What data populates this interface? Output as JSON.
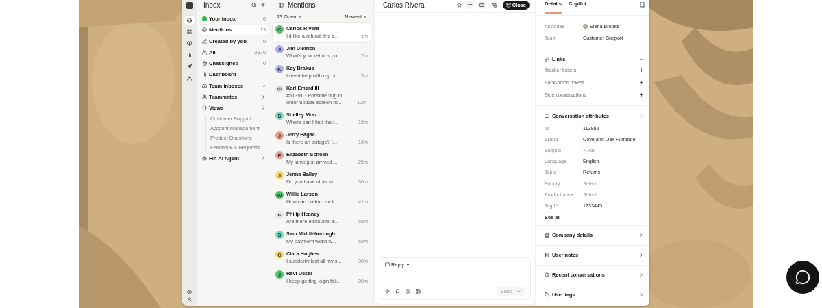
{
  "rail": [
    {
      "selected": true
    },
    {
      "selected": false
    },
    {
      "selected": false
    },
    {
      "selected": false
    },
    {
      "selected": false
    },
    {
      "selected": false
    }
  ],
  "inbox": {
    "title": "Inbox",
    "items": [
      {
        "label": "Your inbox",
        "kind": "count",
        "count": "0",
        "selected": false
      },
      {
        "label": "Mentions",
        "kind": "count",
        "count": "13",
        "selected": true
      },
      {
        "label": "Created by you",
        "kind": "count",
        "count": "0",
        "selected": false
      },
      {
        "label": "All",
        "kind": "count",
        "count": "2370",
        "selected": false
      },
      {
        "label": "Unassigned",
        "kind": "count",
        "count": "0",
        "selected": false
      },
      {
        "label": "Dashboard",
        "kind": "link",
        "selected": false
      },
      {
        "label": "Team inboxes",
        "kind": "folder",
        "expanded": true,
        "selected": false
      },
      {
        "label": "Teammates",
        "kind": "folder",
        "expanded": false,
        "selected": false
      },
      {
        "label": "Views",
        "kind": "folder",
        "expanded": false,
        "selected": false,
        "children": [
          {
            "label": "Customer Support"
          },
          {
            "label": "Account Management"
          },
          {
            "label": "Product Questions"
          },
          {
            "label": "Feedback & Requests"
          }
        ]
      },
      {
        "label": "Fin AI Agent",
        "kind": "folder",
        "expanded": false,
        "selected": false
      }
    ]
  },
  "mentions": {
    "title": "Mentions",
    "filter": "13 Open",
    "sort": "Newest",
    "conversations": [
      {
        "name": "Carlos Rivera",
        "preview": "I'd like a refund, the s...",
        "time": "1m",
        "selected": true,
        "avatar": {
          "kind": "letter",
          "letter": "C",
          "color": "#4fc46c"
        }
      },
      {
        "name": "Jim Dietrich",
        "preview": "What's your returns po...",
        "time": "2m",
        "selected": false,
        "avatar": {
          "kind": "letter",
          "letter": "J",
          "color": "#a9acf2"
        }
      },
      {
        "name": "Kay Brakus",
        "preview": "I need help with my or...",
        "time": "3m",
        "selected": false,
        "avatar": {
          "kind": "letter",
          "letter": "K",
          "color": "#a9acf2"
        }
      },
      {
        "name": "Karl Emard III",
        "preview": "#51391 · Possible bug in order update screen no...",
        "time": "10m",
        "selected": false,
        "avatar": {
          "kind": "ticket",
          "color": "#e6e6e4"
        }
      },
      {
        "name": "Shelley Mraz",
        "preview": "Where can I find the l...",
        "time": "15m",
        "selected": false,
        "avatar": {
          "kind": "letter",
          "letter": "S",
          "color": "#72d8c4"
        }
      },
      {
        "name": "Jerry Pagac",
        "preview": "Is there an outage? I...",
        "time": "16m",
        "selected": false,
        "avatar": {
          "kind": "letter",
          "letter": "J",
          "color": "#f29b91"
        }
      },
      {
        "name": "Elizabeth Schoen",
        "preview": "My lamp just arrived,...",
        "time": "25m",
        "selected": false,
        "avatar": {
          "kind": "letter",
          "letter": "E",
          "color": "#f29b91"
        }
      },
      {
        "name": "Jenna Bailey",
        "preview": "Do you have other si...",
        "time": "30m",
        "selected": false,
        "avatar": {
          "kind": "letter",
          "letter": "J",
          "color": "#f7d56c"
        }
      },
      {
        "name": "Willie Larson",
        "preview": "How can I return an it...",
        "time": "41m",
        "selected": false,
        "avatar": {
          "kind": "letter",
          "letter": "W",
          "color": "#4fc46c"
        }
      },
      {
        "name": "Philip Heaney",
        "preview": "Are there discounts a...",
        "time": "58m",
        "selected": false,
        "avatar": {
          "kind": "reply",
          "color": "#e6e6e4"
        }
      },
      {
        "name": "Sam Middleborough",
        "preview": "My payment won't w...",
        "time": "59m",
        "selected": false,
        "avatar": {
          "kind": "letter",
          "letter": "S",
          "color": "#72d8c4"
        }
      },
      {
        "name": "Clara Hughes",
        "preview": "I suddenly lost all my s...",
        "time": "30m",
        "selected": false,
        "avatar": {
          "kind": "letter",
          "letter": "C",
          "color": "#f7d56c"
        }
      },
      {
        "name": "Ravi Desai",
        "preview": "I keep getting login fail...",
        "time": "30m",
        "selected": false,
        "avatar": {
          "kind": "letter",
          "letter": "J",
          "color": "#4fc46c"
        }
      }
    ]
  },
  "conversation": {
    "title": "Carlos Rivera",
    "close_label": "Close",
    "composer": {
      "mode": "Reply",
      "send": "Send"
    }
  },
  "details": {
    "tabs": [
      {
        "label": "Details",
        "selected": true
      },
      {
        "label": "Copilot",
        "selected": false
      }
    ],
    "summary": [
      {
        "label": "Assignee",
        "value": "Elena Brooks",
        "kind": "person"
      },
      {
        "label": "Team",
        "value": "Customer Support",
        "kind": "text"
      }
    ],
    "sections": [
      {
        "title": "Links",
        "kind": "links",
        "expanded": true,
        "rows": [
          {
            "label": "Tracker tickets"
          },
          {
            "label": "Back-office tickets"
          },
          {
            "label": "Side conversations"
          }
        ]
      },
      {
        "title": "Conversation attributes",
        "kind": "attributes",
        "expanded": true,
        "more": "See all",
        "rows": [
          {
            "label": "Id",
            "value": "113962",
            "empty": false
          },
          {
            "label": "Brand",
            "value": "Cove and Oak Furniture",
            "empty": false
          },
          {
            "label": "Subject",
            "value": "+ Add",
            "empty": true
          },
          {
            "label": "Language",
            "value": "English",
            "empty": false
          },
          {
            "label": "Topic",
            "value": "Returns",
            "empty": false
          },
          {
            "label": "Priority",
            "value": "Select",
            "empty": true
          },
          {
            "label": "Product area",
            "value": "Select",
            "empty": true
          },
          {
            "label": "Tag ID",
            "value": "1233445",
            "empty": false
          }
        ]
      },
      {
        "title": "Company details",
        "expanded": false
      },
      {
        "title": "User notes",
        "expanded": false
      },
      {
        "title": "Recent conversations",
        "expanded": false
      },
      {
        "title": "User tags",
        "expanded": false
      }
    ]
  }
}
